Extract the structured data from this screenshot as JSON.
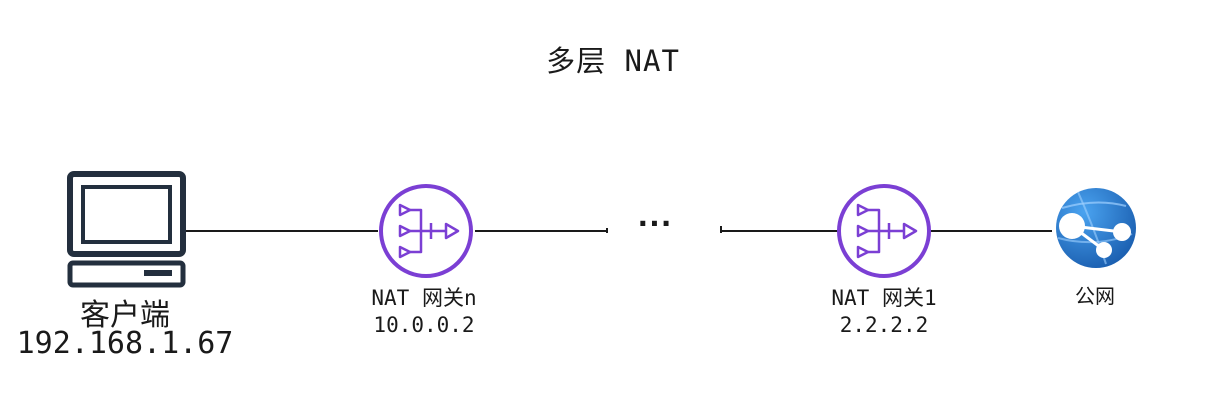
{
  "title": "多层 NAT",
  "client": {
    "name": "客户端",
    "ip": "192.168.1.67"
  },
  "gateways": [
    {
      "name": "NAT 网关n",
      "ip": "10.0.0.2"
    },
    {
      "name": "NAT 网关1",
      "ip": "2.2.2.2"
    }
  ],
  "ellipsis": "...",
  "internet": {
    "label": "公网"
  },
  "colors": {
    "line": "#1a1a1a",
    "computer": "#232f3e",
    "nat": "#7b3fd4",
    "internet_dark": "#1b5fb0",
    "internet_light": "#4aa3f0"
  },
  "icons": {
    "client": "computer-icon",
    "gateway": "nat-gateway-icon",
    "internet": "globe-icon"
  }
}
